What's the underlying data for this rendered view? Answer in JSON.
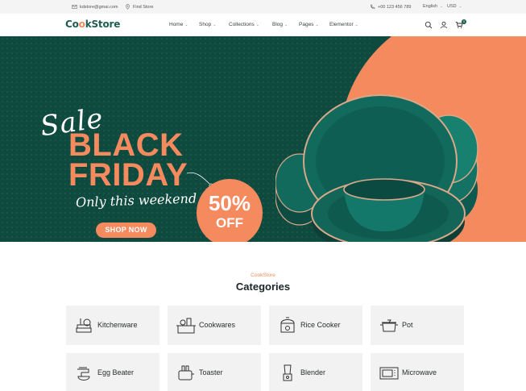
{
  "topbar": {
    "email": "kdstore@gmai.com",
    "find_store": "Find Store",
    "phone": "+00 123 456 789",
    "language": "English",
    "currency": "USD"
  },
  "header": {
    "logo_part1": "C",
    "logo_part2": "o",
    "logo_part3": "o",
    "logo_part4": "kStore",
    "nav": [
      "Home",
      "Shop",
      "Collections",
      "Blog",
      "Pages",
      "Elementor"
    ],
    "cart_count": "0"
  },
  "hero": {
    "sale": "Sale",
    "black": "BLACK",
    "friday": "FRIDAY",
    "weekend": "Only this weekend",
    "discount": "50%",
    "off": "OFF",
    "cta": "SHOP NOW",
    "slides": 3,
    "active_slide": 1
  },
  "categories": {
    "subtitle": "CookStore",
    "title": "Categories",
    "items": [
      {
        "label": "Kitchenware",
        "icon": "kitchenware-icon"
      },
      {
        "label": "Cookwares",
        "icon": "cookware-icon"
      },
      {
        "label": "Rice Cooker",
        "icon": "rice-cooker-icon"
      },
      {
        "label": "Pot",
        "icon": "pot-icon"
      },
      {
        "label": "Egg Beater",
        "icon": "egg-beater-icon"
      },
      {
        "label": "Toaster",
        "icon": "toaster-icon"
      },
      {
        "label": "Blender",
        "icon": "blender-icon"
      },
      {
        "label": "Microwave",
        "icon": "microwave-icon"
      }
    ]
  },
  "colors": {
    "brand_green": "#0f4a3f",
    "accent_orange": "#f58a5e",
    "card_bg": "#f2f2f2"
  }
}
